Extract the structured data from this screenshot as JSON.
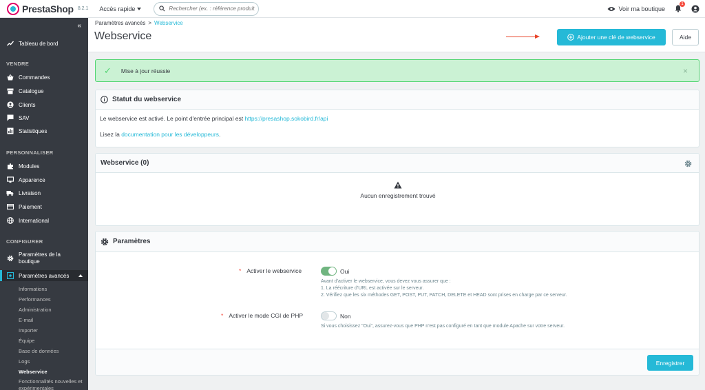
{
  "app": {
    "brand": "PrestaShop",
    "version": "8.2.1"
  },
  "topbar": {
    "quick_access": "Accès rapide",
    "search_placeholder": "Rechercher (ex. : référence produit, no",
    "view_shop": "Voir ma boutique",
    "notifications_count": "1"
  },
  "sidebar": {
    "dashboard": "Tableau de bord",
    "section_sell": "VENDRE",
    "sell_items": [
      "Commandes",
      "Catalogue",
      "Clients",
      "SAV",
      "Statistiques"
    ],
    "section_customize": "PERSONNALISER",
    "customize_items": [
      "Modules",
      "Apparence",
      "Livraison",
      "Paiement",
      "International"
    ],
    "section_configure": "CONFIGURER",
    "shop_params": "Paramètres de la boutique",
    "advanced_params": "Paramètres avancés",
    "advanced_sub": [
      "Informations",
      "Performances",
      "Administration",
      "E-mail",
      "Importer",
      "Équipe",
      "Base de données",
      "Logs",
      "Webservice",
      "Fonctionnalités nouvelles et expérimentales"
    ]
  },
  "header": {
    "breadcrumb_parent": "Paramètres avancés",
    "breadcrumb_sep": ">",
    "breadcrumb_current": "Webservice",
    "title": "Webservice",
    "add_key_button": "Ajouter une clé de webservice",
    "help_button": "Aide"
  },
  "alert": {
    "message": "Mise à jour réussie"
  },
  "status_card": {
    "title": "Statut du webservice",
    "line1_prefix": "Le webservice est activé. Le point d'entrée principal est ",
    "api_url": "https://presashop.sokobird.fr/api",
    "line2_prefix": "Lisez la ",
    "doc_link": "documentation pour les développeurs",
    "line2_suffix": "."
  },
  "list_card": {
    "title": "Webservice (0)",
    "empty": "Aucun enregistrement trouvé"
  },
  "params_card": {
    "title": "Paramètres",
    "enable_label": "Activer le webservice",
    "enable_value": "Oui",
    "enable_help": [
      "Avant d'activer le webservice, vous devez vous assurer que :",
      "1. La réécriture d'URL est activée sur le serveur.",
      "2. Vérifiez que les six méthodes GET, POST, PUT, PATCH, DELETE et HEAD sont prises en charge par ce serveur."
    ],
    "cgi_label": "Activer le mode CGI de PHP",
    "cgi_value": "Non",
    "cgi_help": "Si vous choisissez \"Oui\", assurez-vous que PHP n'est pas configuré en tant que module Apache sur votre serveur.",
    "required_marker": "*",
    "save_button": "Enregistrer"
  },
  "colors": {
    "accent": "#25b9d7",
    "sidebar": "#363a41",
    "success": "#70b580",
    "arrow": "#e8442a"
  }
}
